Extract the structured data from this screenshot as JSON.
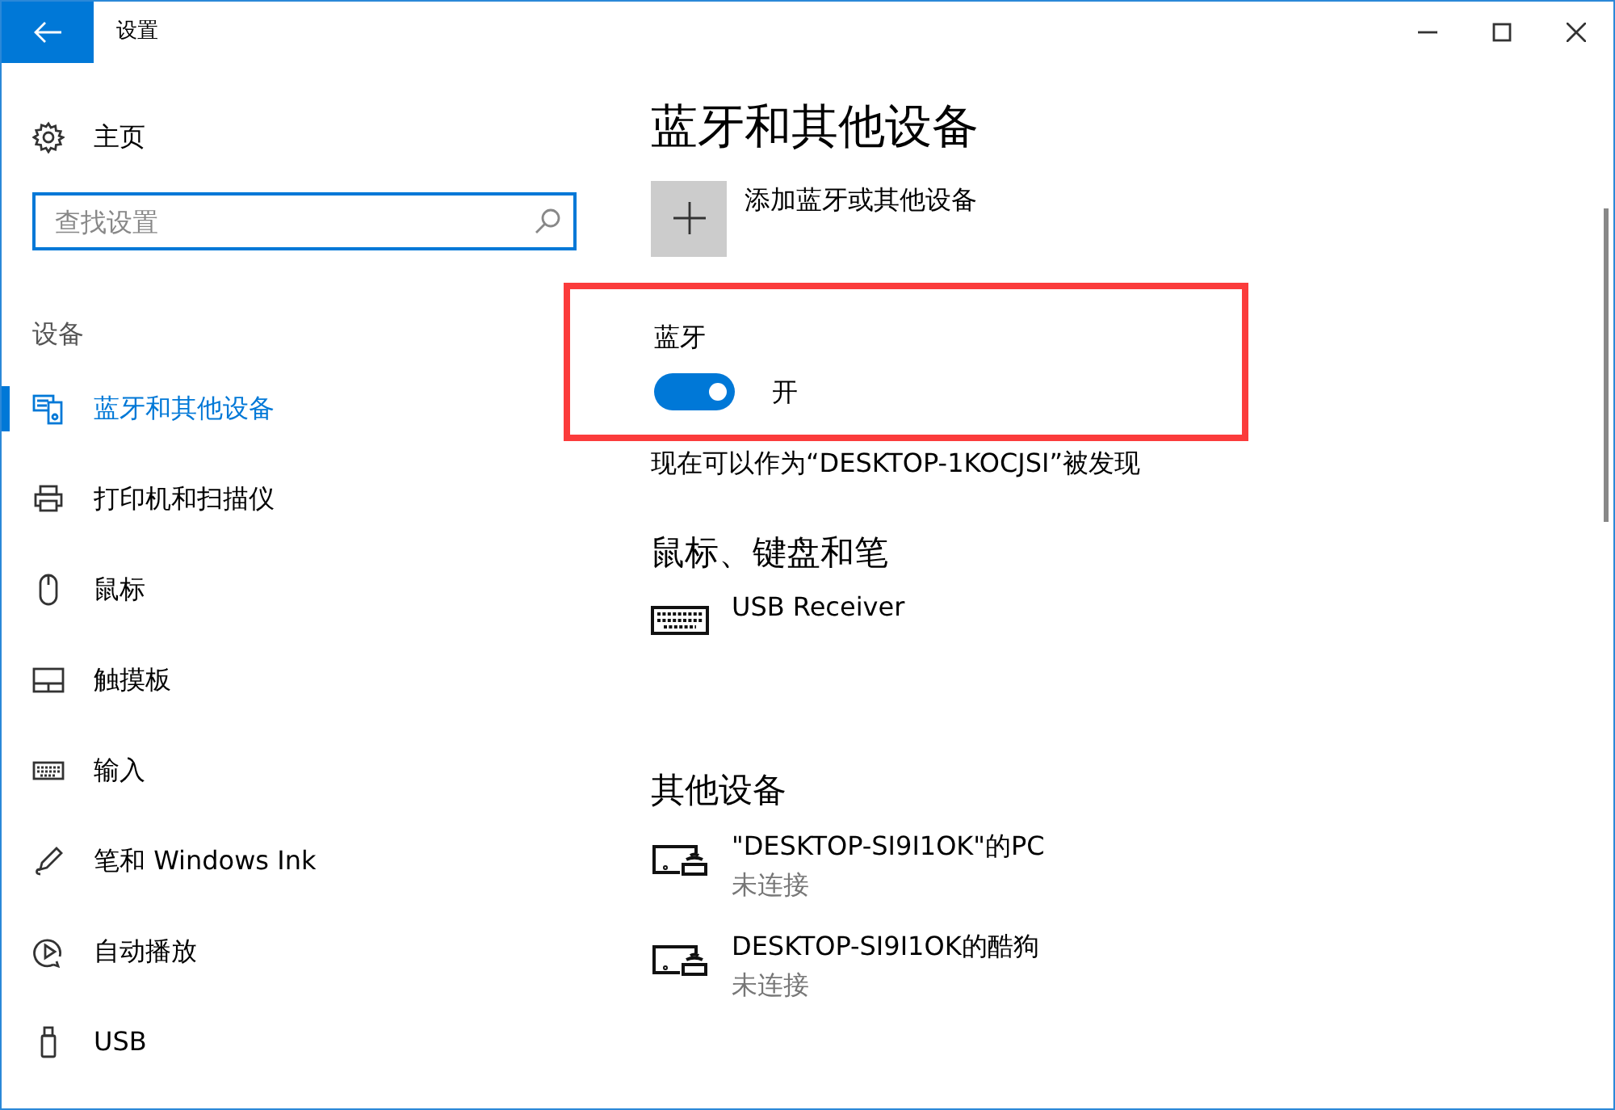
{
  "window": {
    "title": "设置"
  },
  "sidebar": {
    "home": "主页",
    "search": {
      "placeholder": "查找设置"
    },
    "section": "设备",
    "items": [
      {
        "label": "蓝牙和其他设备",
        "selected": true
      },
      {
        "label": "打印机和扫描仪",
        "selected": false
      },
      {
        "label": "鼠标",
        "selected": false
      },
      {
        "label": "触摸板",
        "selected": false
      },
      {
        "label": "输入",
        "selected": false
      },
      {
        "label": "笔和 Windows Ink",
        "selected": false
      },
      {
        "label": "自动播放",
        "selected": false
      },
      {
        "label": "USB",
        "selected": false
      }
    ]
  },
  "page": {
    "title": "蓝牙和其他设备",
    "add_button": "添加蓝牙或其他设备",
    "bluetooth": {
      "label": "蓝牙",
      "on": true,
      "state_text": "开",
      "highlighted": true
    },
    "discoverable": "现在可以作为“DESKTOP-1KOCJSI”被发现",
    "groups": [
      {
        "title": "鼠标、键盘和笔",
        "devices": [
          {
            "kind": "keyboard",
            "name": "USB Receiver"
          }
        ]
      },
      {
        "title": "其他设备",
        "devices": [
          {
            "kind": "display",
            "name": "\"DESKTOP-SI9I1OK\"的PC",
            "status": "未连接"
          },
          {
            "kind": "display",
            "name": "DESKTOP-SI9I1OK的酷狗",
            "status": "未连接"
          }
        ]
      }
    ]
  }
}
